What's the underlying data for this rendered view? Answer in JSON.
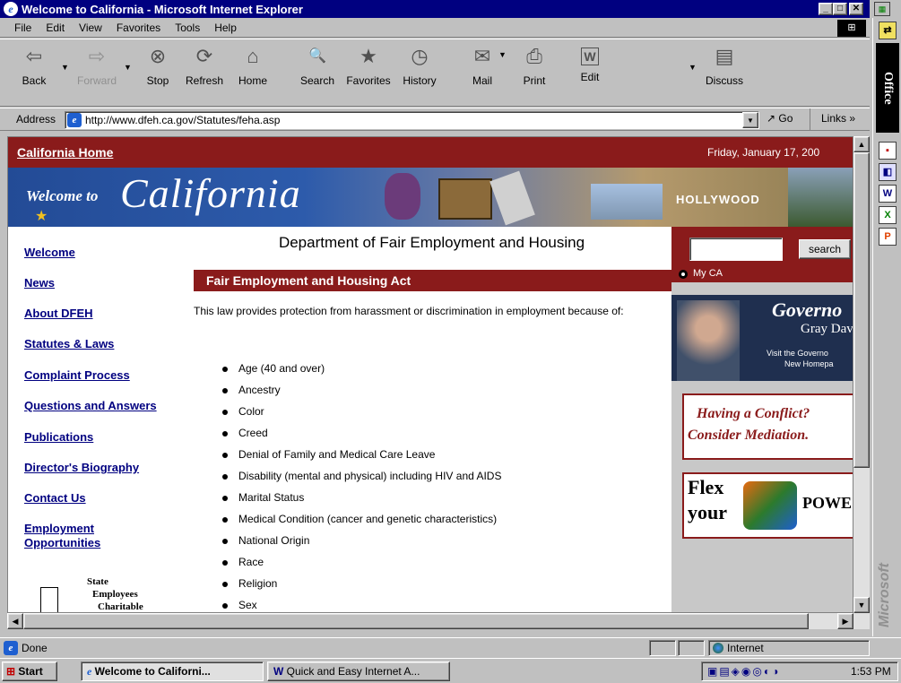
{
  "window": {
    "title": "Welcome to California - Microsoft Internet Explorer",
    "min": "_",
    "max": "□",
    "close": "✕"
  },
  "menu": [
    "File",
    "Edit",
    "View",
    "Favorites",
    "Tools",
    "Help"
  ],
  "toolbar": [
    {
      "label": "Back",
      "icon": "⇦",
      "enabled": true
    },
    {
      "label": "Forward",
      "icon": "⇨",
      "enabled": false
    },
    {
      "label": "Stop",
      "icon": "⊗",
      "enabled": true
    },
    {
      "label": "Refresh",
      "icon": "⟳",
      "enabled": true
    },
    {
      "label": "Home",
      "icon": "⌂",
      "enabled": true
    },
    {
      "label": "Search",
      "icon": "🔍",
      "enabled": true
    },
    {
      "label": "Favorites",
      "icon": "★",
      "enabled": true
    },
    {
      "label": "History",
      "icon": "◷",
      "enabled": true
    },
    {
      "label": "Mail",
      "icon": "✉",
      "enabled": true
    },
    {
      "label": "Print",
      "icon": "⎙",
      "enabled": true
    },
    {
      "label": "Edit",
      "icon": "W",
      "enabled": true
    },
    {
      "label": "Discuss",
      "icon": "▤",
      "enabled": true
    }
  ],
  "address": {
    "label": "Address",
    "url": "http://www.dfeh.ca.gov/Statutes/feha.asp",
    "go": "Go",
    "links": "Links"
  },
  "office": {
    "label": "Office",
    "brand": "Microsoft"
  },
  "page": {
    "home_link": "California Home",
    "date": "Friday, January 17, 200",
    "banner_welcome": "Welcome to",
    "banner_california": "California",
    "banner_hollywood": "HOLLYWOOD",
    "dept_title": "Department of Fair Employment and Housing",
    "section_title": "Fair Employment and Housing Act",
    "intro": "This law provides protection from harassment or discrimination in employment because of:",
    "bullets": [
      "Age (40 and over)",
      "Ancestry",
      "Color",
      "Creed",
      "Denial of Family and Medical Care Leave",
      "Disability (mental and physical) including HIV and AIDS",
      "Marital Status",
      "Medical Condition (cancer and genetic characteristics)",
      "National Origin",
      "Race",
      "Religion",
      "Sex"
    ],
    "nav": [
      "Welcome",
      "News",
      "About DFEH",
      "Statutes & Laws",
      "Complaint Process",
      "Questions and Answers",
      "Publications",
      "Director's Biography",
      "Contact Us",
      "Employment Opportunities"
    ],
    "charity": [
      "State",
      "Employees",
      "Charitable"
    ],
    "search_button": "search",
    "my_ca": "My CA",
    "gov_title": "Governo",
    "gov_name": "Gray Dav",
    "gov_visit1": "Visit the Governo",
    "gov_visit2": "New Homepa",
    "conflict1": "Having a Conflict?",
    "conflict2": "Consider Mediation.",
    "flex1": "Flex",
    "flex2": "your",
    "flex3": "POWE"
  },
  "status": {
    "text": "Done",
    "zone": "Internet"
  },
  "taskbar": {
    "start": "Start",
    "tasks": [
      "Welcome to Californi...",
      "Quick and Easy Internet A..."
    ],
    "time": "1:53 PM"
  }
}
